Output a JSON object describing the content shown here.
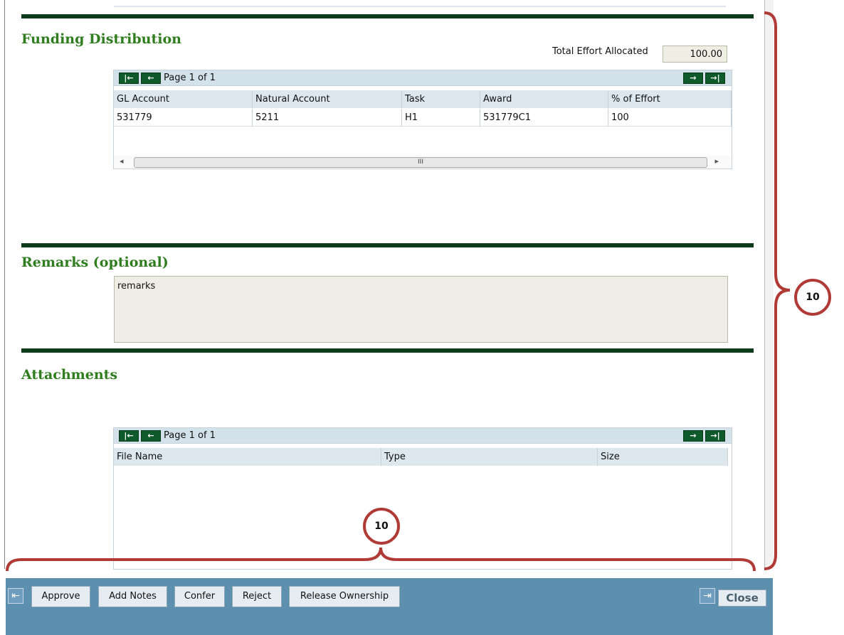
{
  "funding": {
    "title": "Funding Distribution",
    "total_effort_label": "Total Effort Allocated",
    "total_effort_value": "100.00",
    "pager_text": "Page 1 of 1",
    "columns": [
      "GL Account",
      "Natural Account",
      "Task",
      "Award",
      "% of Effort"
    ],
    "rows": [
      [
        "531779",
        "5211",
        "H1",
        "531779C1",
        "100"
      ]
    ],
    "scroll_grip": "III"
  },
  "remarks": {
    "title": "Remarks (optional)",
    "value": "remarks"
  },
  "attachments": {
    "title": "Attachments",
    "pager_text": "Page 1 of 1",
    "columns": [
      "File Name",
      "Type",
      "Size"
    ]
  },
  "toolbar": {
    "buttons": [
      "Approve",
      "Add Notes",
      "Confer",
      "Reject",
      "Release Ownership"
    ],
    "close_label": "Close"
  },
  "callouts": {
    "right_number": "10",
    "bottom_number": "10",
    "color": "#b03a35"
  },
  "colors": {
    "section_title": "#2f7d1e",
    "rule": "#0d3b1c",
    "toolbar_bg": "#5d8faf",
    "pager_button": "#0f5a2a"
  }
}
